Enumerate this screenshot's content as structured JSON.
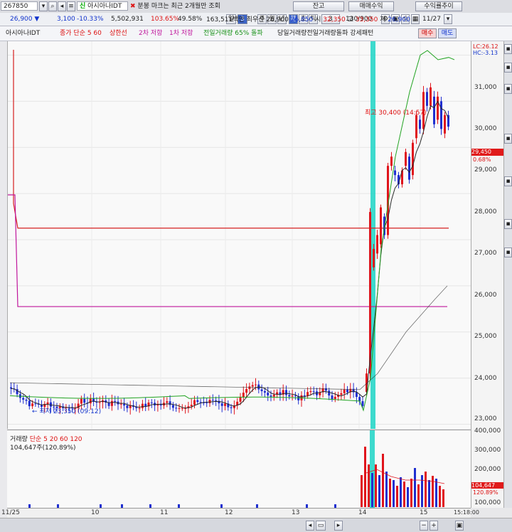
{
  "header": {
    "stock_code": "267850",
    "stock_name": "아시아나IDT",
    "marker_text": "분봉 마크는 최근 2개월만 조회",
    "top_buttons": [
      "잔고",
      "매매수익",
      "수익률추이"
    ],
    "price": "26,900",
    "change": "3,100",
    "change_pct": "-10.33%",
    "volume": "5,502,931",
    "vol_ratio": "103.65%",
    "turnover": "49.58%",
    "amount": "163,511백만",
    "best_ask_label": "최우선",
    "best_ask": "26,900",
    "best_bid": "26,850",
    "open_label": "시",
    "open": "32,350",
    "high_label": "고",
    "high": "33,350",
    "low_label": "저",
    "low": "26,900",
    "period_tabs": [
      "일",
      "3",
      "주",
      "월",
      "년",
      "분",
      "초",
      "틱",
      "3"
    ],
    "count": "130/900",
    "date": "11/27",
    "buy_label": "매수",
    "sell_label": "매도"
  },
  "legend": {
    "name": "아시아나IDT",
    "price_ma": "종가 단순 5 60",
    "upper_limit": "상한선",
    "support2": "2차 저항",
    "support1": "1차 저항",
    "prev_vol": "전일거래량 65% 돌파",
    "prev_vol_pattern": "당일거래량전일거래량돌파 강세패턴"
  },
  "annotations": {
    "high": "최고 30,400 (14:57)",
    "low": "← 최저 23,350 (09:12)",
    "lc": "LC:26.12",
    "hc": "HC:-3.13",
    "current_price_tag": "29,450",
    "current_pct_tag": "0.68%"
  },
  "volume_panel": {
    "title": "거래량",
    "ma_label": "단순 5 20 60 120",
    "current": "104,647주(120.89%)",
    "vol_tag": "104,647",
    "vol_pct_tag": "120.89%"
  },
  "y_axis": [
    "31,000",
    "30,000",
    "29,000",
    "28,000",
    "27,000",
    "26,000",
    "25,000",
    "24,000",
    "23,000"
  ],
  "vol_axis": [
    "400,000",
    "300,000",
    "200,000",
    "100,000"
  ],
  "x_axis": [
    "11/25",
    "10",
    "11",
    "12",
    "13",
    "14",
    "15"
  ],
  "time_label": "15:18:00",
  "colors": {
    "up": "#e0141c",
    "down": "#1f2fd0",
    "ma5": "#2a2a2a",
    "ma60": "#21a321",
    "upper": "#d62020",
    "res": "#c0169c",
    "highlight": "#28d6c8"
  },
  "chart_data": {
    "type": "line",
    "title": "아시아나IDT",
    "ylim": [
      22900,
      31300
    ],
    "annotations": [
      {
        "label": "최고",
        "value": 30400,
        "time": "14:57"
      },
      {
        "label": "최저",
        "value": 23350,
        "time": "09:12"
      }
    ],
    "series": [
      {
        "name": "종가 단순 5",
        "values": [
          23800,
          23700,
          23900,
          23850,
          23800,
          23800,
          23750,
          24200,
          26500,
          27800,
          28500,
          29200,
          30000,
          29500
        ]
      },
      {
        "name": "상한선",
        "values": [
          27250,
          27250
        ]
      },
      {
        "name": "2차 저항",
        "values": [
          25550,
          25550
        ]
      }
    ]
  }
}
